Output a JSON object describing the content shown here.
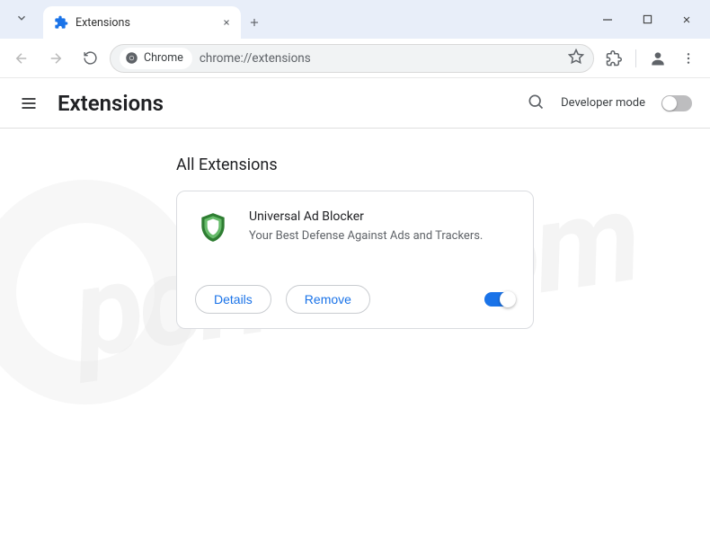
{
  "tab": {
    "title": "Extensions"
  },
  "omnibox": {
    "chip_label": "Chrome",
    "url": "chrome://extensions"
  },
  "page": {
    "title": "Extensions",
    "developer_mode_label": "Developer mode",
    "section_title": "All Extensions"
  },
  "extension": {
    "name": "Universal Ad Blocker",
    "description": "Your Best Defense Against Ads and Trackers.",
    "details_label": "Details",
    "remove_label": "Remove",
    "enabled": true
  },
  "watermark": "pcrisk.com"
}
